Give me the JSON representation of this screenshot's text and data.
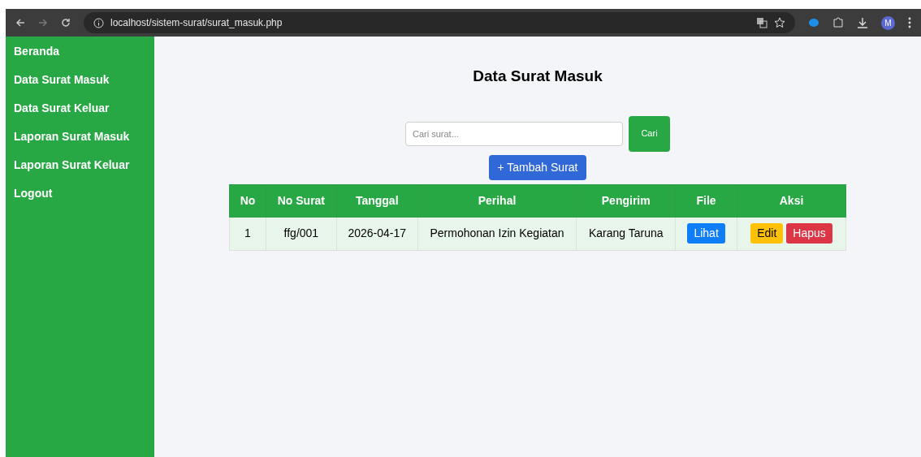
{
  "browser": {
    "url": "localhost/sistem-surat/surat_masuk.php",
    "profile_initial": "M"
  },
  "sidebar": {
    "items": [
      {
        "label": "Beranda"
      },
      {
        "label": "Data Surat Masuk"
      },
      {
        "label": "Data Surat Keluar"
      },
      {
        "label": "Laporan Surat Masuk"
      },
      {
        "label": "Laporan Surat Keluar"
      },
      {
        "label": "Logout"
      }
    ]
  },
  "title": "Data Surat Masuk",
  "search": {
    "placeholder": "Cari surat...",
    "button": "Cari"
  },
  "add_button": "+ Tambah Surat",
  "table": {
    "columns": [
      "No",
      "No Surat",
      "Tanggal",
      "Perihal",
      "Pengirim",
      "File",
      "Aksi"
    ],
    "rows": [
      {
        "cells": [
          "1",
          "ffg/001",
          "2026-04-17",
          "Permohonan Izin Kegiatan",
          "Karang Taruna"
        ],
        "file_button": "Lihat",
        "actions": [
          {
            "kind": "edit",
            "label": "Edit"
          },
          {
            "kind": "delete",
            "label": "Hapus"
          }
        ]
      }
    ]
  }
}
